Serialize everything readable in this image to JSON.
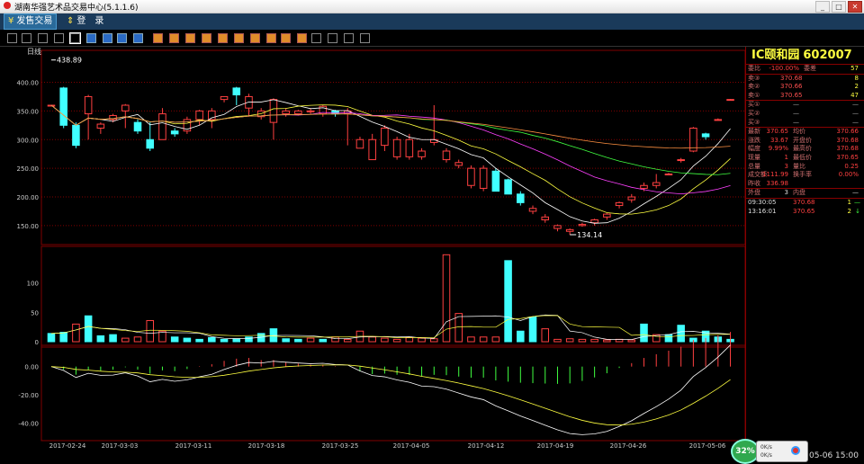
{
  "window": {
    "title": "湖南华强艺术品交易中心(5.1.1.6)"
  },
  "menu": [
    {
      "icon": "¥",
      "label": "发售交易",
      "active": true
    },
    {
      "icon": "⇕",
      "label": "登　录",
      "active": false
    }
  ],
  "toolbar_icons": [
    "bar-chart-icon",
    "line-chart-icon",
    "candles-icon",
    "list-icon",
    "window-icon",
    "blue-grid-icon",
    "blue-grid-icon",
    "blue-grid-icon",
    "blue-grid-icon",
    "orange-icon",
    "orange-icon",
    "orange-icon",
    "orange-icon",
    "orange-icon",
    "orange-icon",
    "orange-icon",
    "orange-icon",
    "orange-icon",
    "orange-icon",
    "zoom-in-icon",
    "zoom-out-icon",
    "pencil-icon",
    "gear-icon"
  ],
  "chart": {
    "period_label": "日线",
    "price_axis": [
      "400.00",
      "350.00",
      "300.00",
      "250.00",
      "200.00",
      "150.00"
    ],
    "vol_axis": [
      "100",
      "50",
      "0"
    ],
    "macd_axis": [
      "0.00",
      "-20.00",
      "-40.00"
    ],
    "dates": [
      "2017-02-24",
      "2017-03-03",
      "2017-03-11",
      "2017-03-18",
      "2017-03-25",
      "2017-04-05",
      "2017-04-12",
      "2017-04-19",
      "2017-04-26",
      "2017-05-06"
    ],
    "high_label": "438.89",
    "low_label": "134.14",
    "colors": {
      "up": "#ff4040",
      "down": "#40ffff",
      "ma1": "#ffffff",
      "ma2": "#ffff40",
      "ma3": "#ff40ff",
      "ma4": "#40ff40",
      "ma5": "#ff9040",
      "grid": "#800000"
    }
  },
  "chart_data": {
    "type": "candlestick",
    "title": "",
    "ylim": [
      120,
      440
    ],
    "candles": [
      [
        360,
        360,
        358,
        360
      ],
      [
        390,
        325,
        320,
        392
      ],
      [
        325,
        290,
        285,
        330
      ],
      [
        345,
        375,
        300,
        378
      ],
      [
        320,
        327,
        310,
        330
      ],
      [
        335,
        342,
        330,
        345
      ],
      [
        350,
        360,
        320,
        362
      ],
      [
        330,
        315,
        310,
        335
      ],
      [
        300,
        285,
        280,
        330
      ],
      [
        300,
        345,
        300,
        355
      ],
      [
        315,
        310,
        305,
        320
      ],
      [
        315,
        335,
        310,
        340
      ],
      [
        335,
        350,
        325,
        352
      ],
      [
        335,
        350,
        320,
        355
      ],
      [
        370,
        375,
        365,
        375
      ],
      [
        390,
        378,
        360,
        392
      ],
      [
        355,
        375,
        340,
        380
      ],
      [
        340,
        350,
        335,
        355
      ],
      [
        330,
        370,
        300,
        372
      ],
      [
        345,
        350,
        340,
        355
      ],
      [
        345,
        350,
        342,
        352
      ],
      [
        350,
        350,
        345,
        355
      ],
      [
        345,
        358,
        340,
        360
      ],
      [
        350,
        345,
        340,
        352
      ],
      [
        345,
        350,
        290,
        355
      ],
      [
        285,
        300,
        285,
        305
      ],
      [
        265,
        300,
        265,
        310
      ],
      [
        290,
        320,
        280,
        325
      ],
      [
        270,
        300,
        265,
        305
      ],
      [
        270,
        300,
        265,
        310
      ],
      [
        270,
        280,
        265,
        285
      ],
      [
        295,
        300,
        290,
        360
      ],
      [
        265,
        280,
        260,
        285
      ],
      [
        255,
        260,
        250,
        265
      ],
      [
        220,
        250,
        215,
        255
      ],
      [
        215,
        250,
        210,
        255
      ],
      [
        245,
        210,
        210,
        250
      ],
      [
        230,
        205,
        205,
        232
      ],
      [
        205,
        190,
        185,
        210
      ],
      [
        175,
        180,
        170,
        185
      ],
      [
        160,
        165,
        155,
        170
      ],
      [
        145,
        150,
        140,
        152
      ],
      [
        140,
        143,
        134,
        145
      ],
      [
        150,
        152,
        148,
        155
      ],
      [
        155,
        160,
        150,
        162
      ],
      [
        165,
        170,
        160,
        172
      ],
      [
        185,
        190,
        180,
        192
      ],
      [
        195,
        200,
        190,
        205
      ],
      [
        215,
        220,
        210,
        225
      ],
      [
        220,
        225,
        215,
        240
      ],
      [
        240,
        240,
        238,
        242
      ],
      [
        265,
        265,
        260,
        268
      ],
      [
        280,
        320,
        278,
        322
      ],
      [
        310,
        305,
        300,
        312
      ],
      [
        335,
        335,
        333,
        337
      ],
      [
        370,
        370,
        369,
        371
      ]
    ],
    "volume": [
      14,
      16,
      30,
      44,
      10,
      12,
      6,
      8,
      36,
      18,
      8,
      6,
      4,
      7,
      4,
      5,
      8,
      14,
      22,
      5,
      4,
      6,
      4,
      8,
      4,
      18,
      8,
      6,
      4,
      7,
      6,
      5,
      148,
      48,
      8,
      8,
      8,
      138,
      18,
      42,
      22,
      4,
      5,
      4,
      4,
      3,
      4,
      3,
      30,
      12,
      12,
      28,
      6,
      18,
      8,
      4
    ],
    "volume_up": [
      false,
      false,
      true,
      false,
      false,
      false,
      true,
      true,
      true,
      true,
      false,
      false,
      false,
      false,
      false,
      false,
      false,
      false,
      false,
      false,
      false,
      true,
      false,
      true,
      true,
      true,
      true,
      true,
      true,
      true,
      true,
      true,
      true,
      true,
      true,
      true,
      true,
      false,
      false,
      false,
      true,
      true,
      true,
      true,
      true,
      true,
      true,
      true,
      false,
      true,
      false,
      false,
      false,
      false,
      false,
      false
    ],
    "macd_labels": [
      "0.00",
      "-20.00",
      "-40.00"
    ]
  },
  "quote": {
    "name": "IC颐和园",
    "code": "602007",
    "weibi": {
      "label": "委比",
      "value": "-100.00%",
      "label2": "委差",
      "value2": "57"
    },
    "asks": [
      {
        "label": "卖③",
        "price": "370.68",
        "qty": "8"
      },
      {
        "label": "卖②",
        "price": "370.66",
        "qty": "2"
      },
      {
        "label": "卖①",
        "price": "370.65",
        "qty": "47"
      }
    ],
    "bids": [
      {
        "label": "买①",
        "price": "—",
        "qty": "—"
      },
      {
        "label": "买②",
        "price": "—",
        "qty": "—"
      },
      {
        "label": "买③",
        "price": "—",
        "qty": "—"
      }
    ],
    "stats": [
      {
        "l1": "最新",
        "v1": "370.65",
        "l2": "均价",
        "v2": "370.66"
      },
      {
        "l1": "涨跌",
        "v1": "33.67",
        "l2": "开盘价",
        "v2": "370.68"
      },
      {
        "l1": "幅度",
        "v1": "9.99%",
        "l2": "最高价",
        "v2": "370.68"
      },
      {
        "l1": "现量",
        "v1": "1",
        "l2": "最低价",
        "v2": "370.65"
      },
      {
        "l1": "总量",
        "v1": "3",
        "l2": "量比",
        "v2": "0.25"
      },
      {
        "l1": "成交额",
        "v1": "1111.99",
        "l2": "换手率",
        "v2": "0.00%"
      },
      {
        "l1": "昨收",
        "v1": "336.98",
        "l2": "",
        "v2": ""
      }
    ],
    "outer": {
      "l1": "外盘",
      "v1": "3",
      "l2": "内盘",
      "v2": "—"
    },
    "ticks": [
      {
        "time": "09:30:05",
        "price": "370.68",
        "qty": "1",
        "dir": "—"
      },
      {
        "time": "13:16:01",
        "price": "370.65",
        "qty": "2",
        "dir": "↓"
      }
    ]
  },
  "status": {
    "badge": "32%",
    "net_up": "0K/s",
    "net_down": "0K/s",
    "clock": "05-06 15:00"
  }
}
